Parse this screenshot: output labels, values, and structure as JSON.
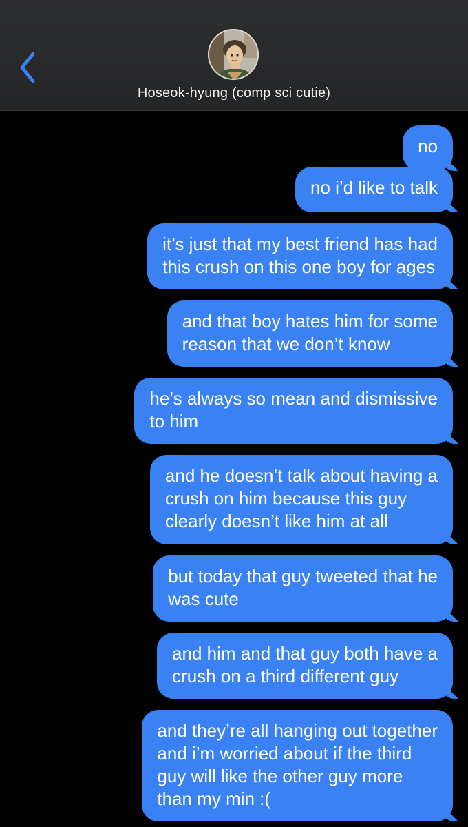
{
  "header": {
    "back_icon": "chevron-left-icon",
    "contact_name": "Hoseok-hyung (comp sci cutie)",
    "accent_color": "#3a81f3"
  },
  "messages": [
    {
      "text": "no"
    },
    {
      "text": "no i’d like to talk"
    },
    {
      "text": "it’s just that my best friend has had\nthis crush on this one boy for ages"
    },
    {
      "text": "and that boy hates him for some\nreason that we don’t know"
    },
    {
      "text": "he’s always so mean and dismissive\nto him"
    },
    {
      "text": "and he doesn’t talk about having a\ncrush on him because this guy\nclearly doesn’t like him at all"
    },
    {
      "text": "but today that guy tweeted that he\nwas cute"
    },
    {
      "text": "and him and that guy both have a\ncrush on a third different guy"
    },
    {
      "text": "and they’re all hanging out together\nand i’m worried about if the third\nguy will like the other guy more\nthan my min :("
    }
  ]
}
